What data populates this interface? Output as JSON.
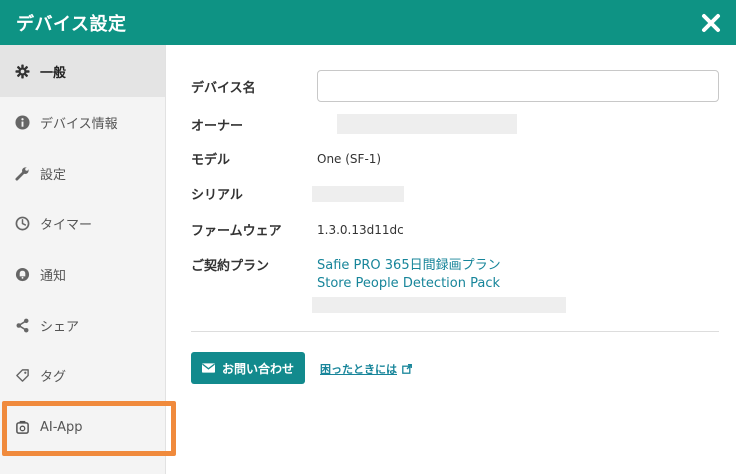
{
  "header": {
    "title": "デバイス設定",
    "close_icon": "close-icon"
  },
  "sidebar": {
    "items": [
      {
        "label": "一般",
        "icon": "gear-icon",
        "active": true
      },
      {
        "label": "デバイス情報",
        "icon": "info-icon"
      },
      {
        "label": "設定",
        "icon": "wrench-icon"
      },
      {
        "label": "タイマー",
        "icon": "clock-icon"
      },
      {
        "label": "通知",
        "icon": "bell-icon"
      },
      {
        "label": "シェア",
        "icon": "share-icon"
      },
      {
        "label": "タグ",
        "icon": "tag-icon"
      },
      {
        "label": "AI-App",
        "icon": "ai-app-icon"
      }
    ],
    "highlight_color": "#f08a3c"
  },
  "form": {
    "device_name": {
      "label": "デバイス名",
      "value": "",
      "placeholder": ""
    },
    "owner": {
      "label": "オーナー"
    },
    "model": {
      "label": "モデル",
      "value": "One (SF-1)"
    },
    "serial": {
      "label": "シリアル"
    },
    "firmware": {
      "label": "ファームウェア",
      "value": "1.3.0.13d11dc"
    },
    "plan": {
      "label": "ご契約プラン",
      "items": [
        "Safie PRO 365日間録画プラン",
        "Store People Detection Pack"
      ]
    }
  },
  "actions": {
    "contact_label": "お問い合わせ",
    "help_label": "困ったときには"
  },
  "colors": {
    "accent": "#0e9384",
    "button": "#128a8d",
    "link": "#17859a"
  }
}
